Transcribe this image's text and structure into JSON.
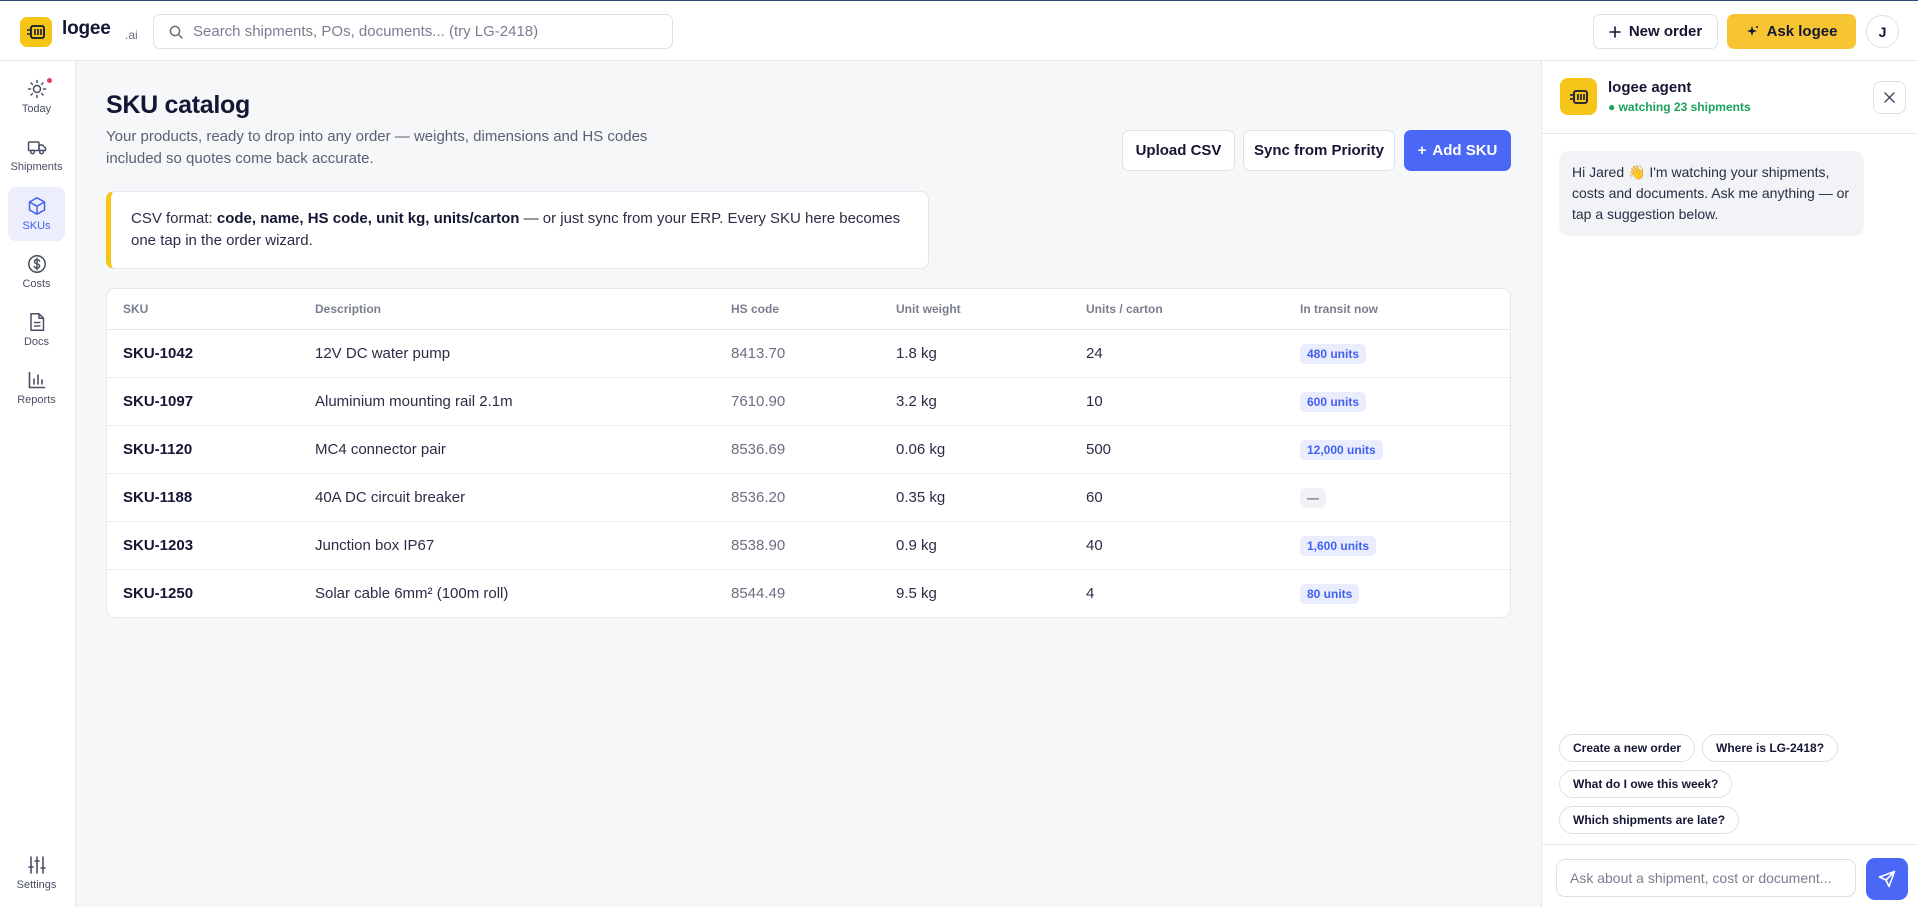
{
  "header": {
    "brand": "logee",
    "brand_suffix": ".ai",
    "search_placeholder": "Search shipments, POs, documents... (try LG-2418)",
    "new_order_label": "New order",
    "ask_label": "Ask logee",
    "avatar_initial": "J"
  },
  "nav": {
    "items": [
      {
        "label": "Today",
        "icon": "sun-icon",
        "has_alert_dot": true
      },
      {
        "label": "Shipments",
        "icon": "truck-icon"
      },
      {
        "label": "SKUs",
        "icon": "box-icon",
        "active": true
      },
      {
        "label": "Costs",
        "icon": "dollar-icon"
      },
      {
        "label": "Docs",
        "icon": "document-icon"
      },
      {
        "label": "Reports",
        "icon": "bar-chart-icon"
      }
    ],
    "settings_label": "Settings"
  },
  "page": {
    "title": "SKU catalog",
    "subtitle": "Your products, ready to drop into any order — weights, dimensions and HS codes included so quotes come back accurate.",
    "upload_label": "Upload CSV",
    "sync_label": "Sync from Priority",
    "add_label": "Add SKU",
    "note": {
      "prefix": "CSV format: ",
      "fields": "code, name, HS code, unit kg, units/carton",
      "suffix": " — or just sync from your ERP. Every SKU here becomes one tap in the order wizard."
    }
  },
  "table": {
    "columns": [
      "SKU",
      "Description",
      "HS code",
      "Unit weight",
      "Units / carton",
      "In transit now"
    ],
    "rows": [
      {
        "sku": "SKU-1042",
        "description": "12V DC water pump",
        "hs": "8413.70",
        "weight": "1.8 kg",
        "units": "24",
        "transit": "480 units"
      },
      {
        "sku": "SKU-1097",
        "description": "Aluminium mounting rail 2.1m",
        "hs": "7610.90",
        "weight": "3.2 kg",
        "units": "10",
        "transit": "600 units"
      },
      {
        "sku": "SKU-1120",
        "description": "MC4 connector pair",
        "hs": "8536.69",
        "weight": "0.06 kg",
        "units": "500",
        "transit": "12,000 units"
      },
      {
        "sku": "SKU-1188",
        "description": "40A DC circuit breaker",
        "hs": "8536.20",
        "weight": "0.35 kg",
        "units": "60",
        "transit": "—"
      },
      {
        "sku": "SKU-1203",
        "description": "Junction box IP67",
        "hs": "8538.90",
        "weight": "0.9 kg",
        "units": "40",
        "transit": "1,600 units"
      },
      {
        "sku": "SKU-1250",
        "description": "Solar cable 6mm² (100m roll)",
        "hs": "8544.49",
        "weight": "9.5 kg",
        "units": "4",
        "transit": "80 units"
      }
    ]
  },
  "agent": {
    "name": "logee agent",
    "status": "● watching 23 shipments",
    "greeting": "Hi Jared 👋 I'm watching your shipments, costs and documents. Ask me anything — or tap a suggestion below.",
    "suggestions": [
      "Create a new order",
      "Where is LG-2418?",
      "What do I owe this week?",
      "Which shipments are late?"
    ],
    "input_placeholder": "Ask about a shipment, cost or document..."
  },
  "colors": {
    "accent": "#4a67f5",
    "brand_yellow": "#f5c518",
    "status_green": "#19a35a",
    "alert_red": "#e53e5b"
  }
}
